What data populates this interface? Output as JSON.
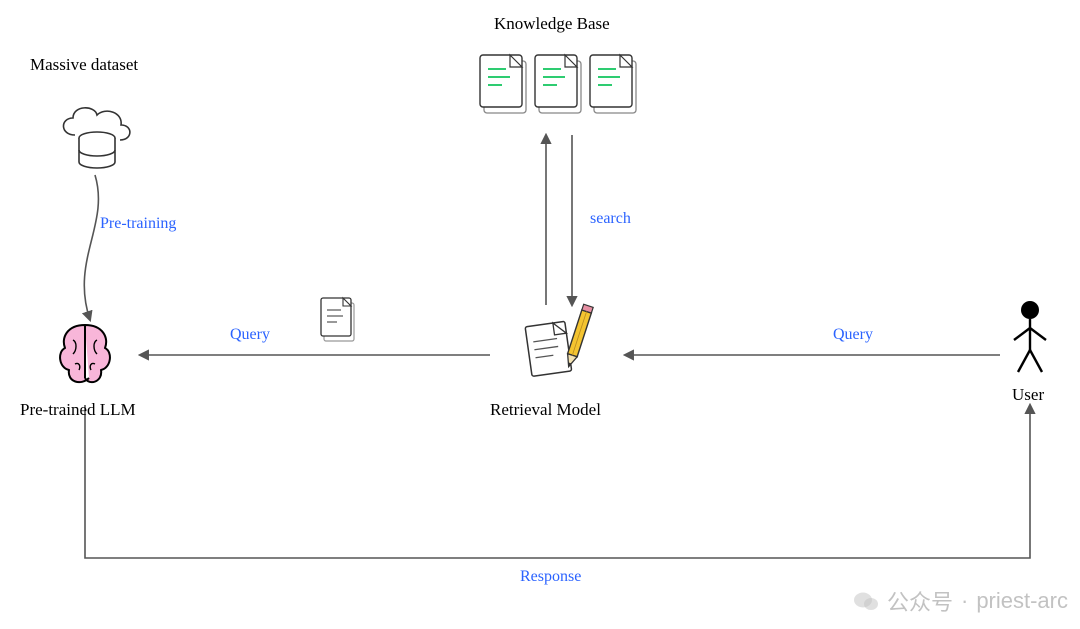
{
  "nodes": {
    "massive_dataset": {
      "label": "Massive dataset"
    },
    "knowledge_base": {
      "label": "Knowledge Base"
    },
    "pretrained_llm": {
      "label": "Pre-trained LLM"
    },
    "retrieval_model": {
      "label": "Retrieval Model"
    },
    "user": {
      "label": "User"
    }
  },
  "edges": {
    "pretraining": {
      "label": "Pre-training"
    },
    "search": {
      "label": "search"
    },
    "query_to_llm": {
      "label": "Query"
    },
    "query_from_user": {
      "label": "Query"
    },
    "response": {
      "label": "Response"
    }
  },
  "icons": {
    "cloud_db": "cloud-database-icon",
    "documents": "documents-icon",
    "brain": "brain-icon",
    "note_pencil": "note-pencil-icon",
    "mini_doc": "document-icon",
    "user_stick": "user-stick-figure-icon"
  },
  "watermark": {
    "prefix": "公众号",
    "separator": "·",
    "name": "priest-arc"
  }
}
